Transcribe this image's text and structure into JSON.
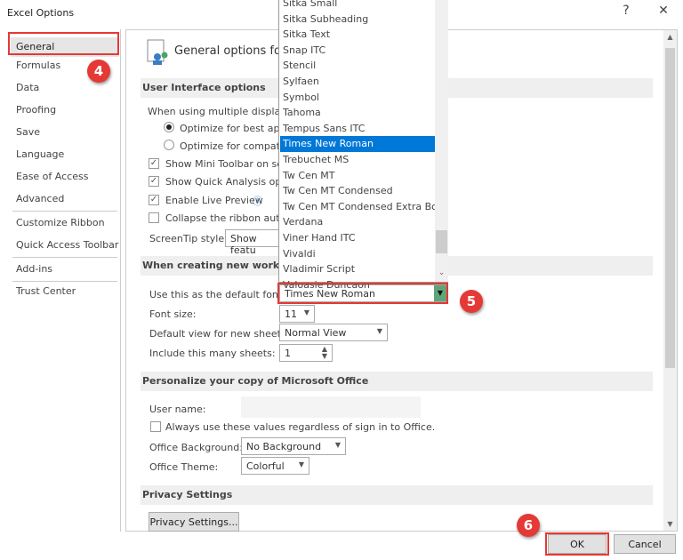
{
  "window": {
    "title": "Excel Options",
    "help": "?",
    "close": "✕"
  },
  "nav": {
    "items": [
      "General",
      "Formulas",
      "Data",
      "Proofing",
      "Save",
      "Language",
      "Ease of Access",
      "Advanced",
      "Customize Ribbon",
      "Quick Access Toolbar",
      "Add-ins",
      "Trust Center"
    ],
    "selected": "General"
  },
  "header": "General options for w",
  "ui_options": {
    "title": "User Interface options",
    "multi_display": "When using multiple displays:",
    "opt_best": "Optimize for best appe",
    "opt_compat": "Optimize for compatib",
    "mini_toolbar": "Show Mini Toolbar on sele",
    "quick_analysis": "Show Quick Analysis optio",
    "live_preview": "Enable Live Preview",
    "collapse_ribbon": "Collapse the ribbon autom",
    "screentip_label": "ScreenTip style:",
    "screentip_value": "Show featu"
  },
  "new_workbook": {
    "title": "When creating new workbook",
    "font_label": "Use this as the default font:",
    "font_value": "Times New Roman",
    "size_label": "Font size:",
    "size_value": "11",
    "view_label": "Default view for new sheets:",
    "view_value": "Normal View",
    "sheets_label": "Include this many sheets:",
    "sheets_value": "1"
  },
  "personalize": {
    "title": "Personalize your copy of Microsoft Office",
    "username_label": "User name:",
    "always_use": "Always use these values regardless of sign in to Office.",
    "background_label": "Office Background:",
    "background_value": "No Background",
    "theme_label": "Office Theme:",
    "theme_value": "Colorful"
  },
  "privacy": {
    "title": "Privacy Settings",
    "button": "Privacy Settings..."
  },
  "font_list": {
    "items": [
      "Sitka Small",
      "Sitka Subheading",
      "Sitka Text",
      "Snap ITC",
      "Stencil",
      "Sylfaen",
      "Symbol",
      "Tahoma",
      "Tempus Sans ITC",
      "Times New Roman",
      "Trebuchet MS",
      "Tw Cen MT",
      "Tw Cen MT Condensed",
      "Tw Cen MT Condensed Extra Bold",
      "Verdana",
      "Viner Hand ITC",
      "Vivaldi",
      "Vladimir Script",
      "Valoasie Duncaon"
    ],
    "selected": "Times New Roman"
  },
  "footer": {
    "ok": "OK",
    "cancel": "Cancel"
  },
  "annotations": {
    "step4": "4",
    "step5": "5",
    "step6": "6"
  },
  "colors": {
    "highlight": "#0078d7",
    "annotation": "#e53935"
  }
}
